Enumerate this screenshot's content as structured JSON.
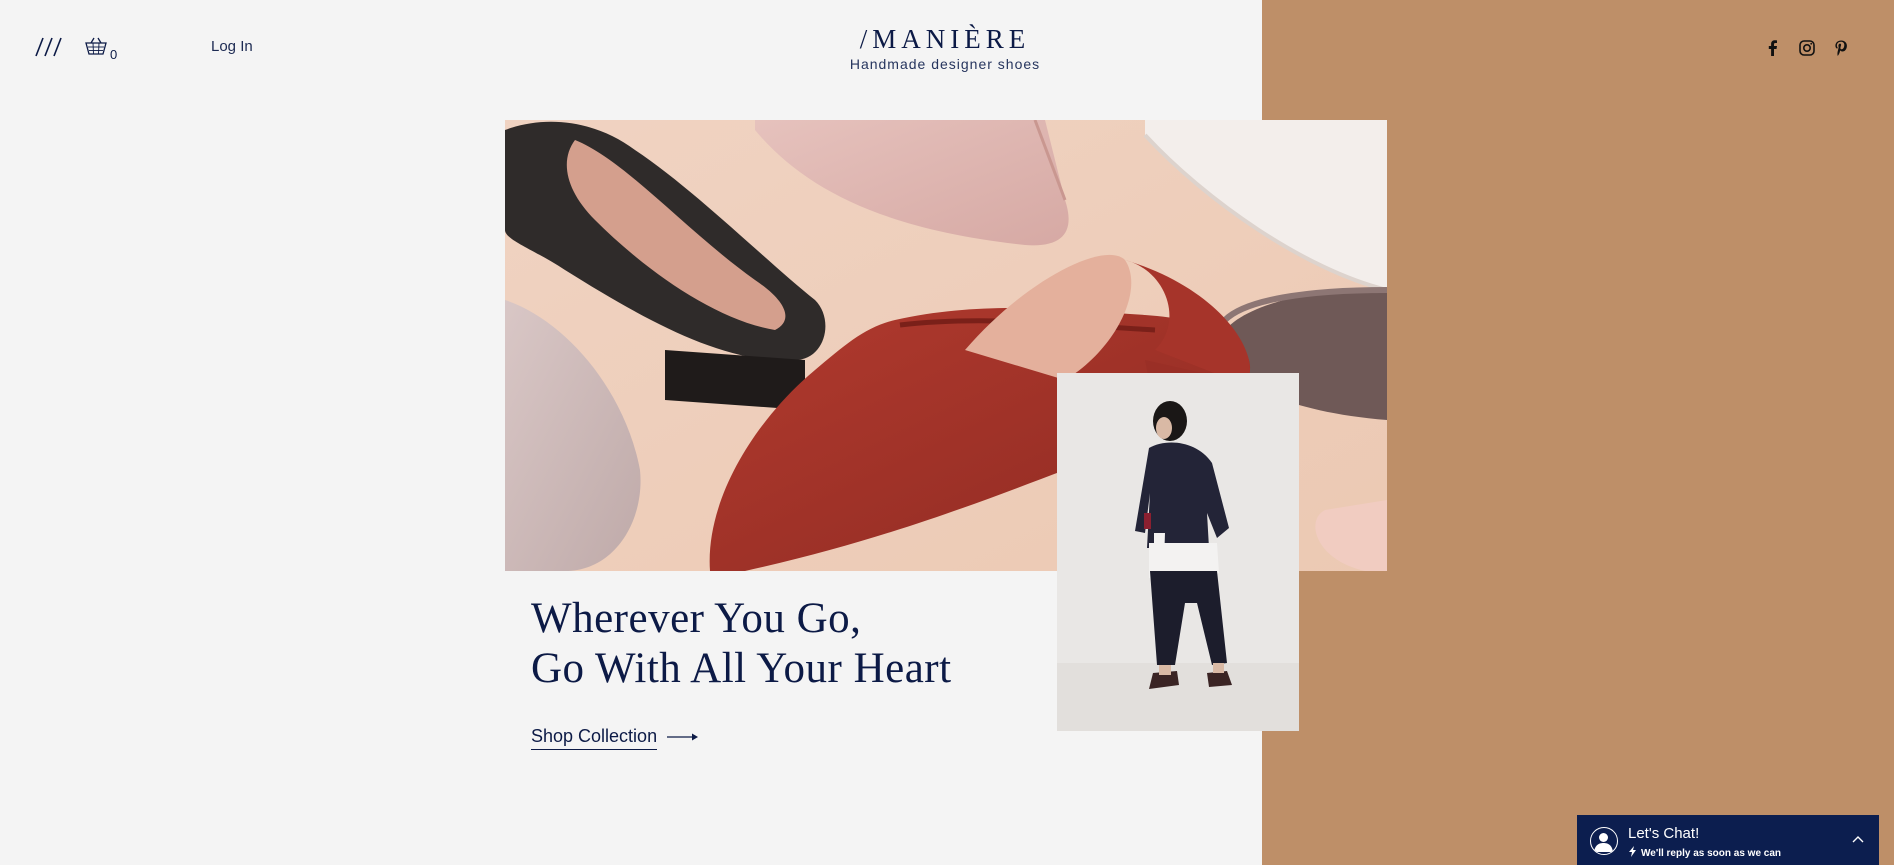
{
  "header": {
    "cart_count": "0",
    "login_label": "Log In",
    "logo_title": "/MANIÈRE",
    "logo_tagline": "Handmade designer shoes",
    "social_icons": [
      "facebook-icon",
      "instagram-icon",
      "pinterest-icon"
    ]
  },
  "hero": {
    "headline_line1": "Wherever You Go,",
    "headline_line2": "Go With All Your Heart",
    "cta_label": "Shop Collection"
  },
  "chat": {
    "title": "Let's Chat!",
    "subtitle": "We'll reply as soon as we can"
  },
  "colors": {
    "background": "#f4f4f4",
    "accent_panel": "#be8f68",
    "navy": "#0c1a46",
    "chat_bg": "#0c1e4f"
  }
}
